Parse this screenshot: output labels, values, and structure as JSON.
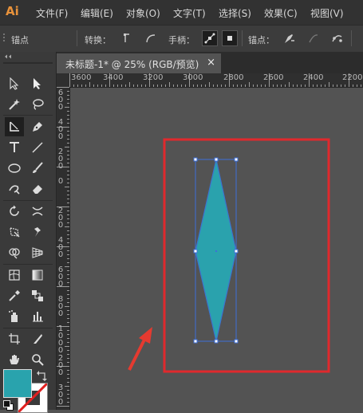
{
  "app": {
    "logo": "Ai"
  },
  "menu": [
    "文件(F)",
    "编辑(E)",
    "对象(O)",
    "文字(T)",
    "选择(S)",
    "效果(C)",
    "视图(V)"
  ],
  "control_bar": {
    "anchor_label": "锚点",
    "convert_label": "转换：",
    "handles_label": "手柄：",
    "anchor_points_label": "锚点："
  },
  "document_tab": {
    "title": "未标题-1* @ 25% (RGB/预览)",
    "close": "×"
  },
  "ruler": {
    "horizontal": [
      "3600",
      "3400",
      "3200",
      "3000",
      "2800",
      "2600",
      "2400",
      "2200"
    ],
    "vertical": [
      [
        "6",
        "0",
        "0"
      ],
      [
        "4",
        "0",
        "0"
      ],
      [
        "2",
        "0",
        "0"
      ],
      [
        "0"
      ],
      [
        "2",
        "0",
        "0"
      ],
      [
        "4",
        "0",
        "0"
      ],
      [
        "6",
        "0",
        "0"
      ],
      [
        "8",
        "0",
        "0"
      ],
      [
        "1",
        "0",
        "0",
        "0"
      ],
      [
        "2",
        "0",
        "0"
      ],
      [
        "3",
        "0",
        "0"
      ]
    ]
  },
  "colors": {
    "fill": "#29a3ad",
    "shape_fill": "#2aa2ad",
    "selection": "#3d6fd8",
    "highlight_box": "#e0292d",
    "arrow": "#e53a30",
    "accent": "#e8923b"
  },
  "icons": {
    "selection": "selection-tool-icon",
    "direct_selection": "direct-selection-tool-icon",
    "anchor": "anchor-point-tool-icon",
    "pen": "pen-tool-icon",
    "type": "type-tool-icon",
    "line": "line-tool-icon",
    "ellipse": "ellipse-tool-icon",
    "brush": "paintbrush-tool-icon",
    "eraser": "eraser-tool-icon",
    "rotate": "rotate-tool-icon",
    "hand": "hand-tool-icon",
    "zoom": "zoom-tool-icon"
  }
}
